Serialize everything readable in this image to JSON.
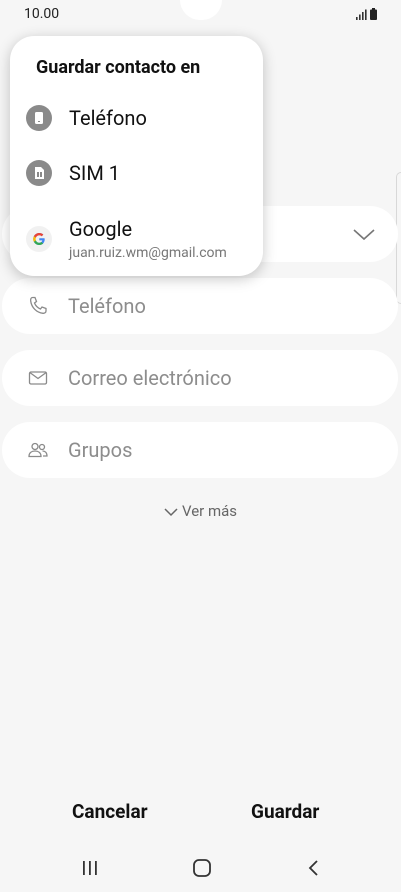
{
  "status_bar": {
    "time": "10.00"
  },
  "popup": {
    "title": "Guardar contacto en",
    "options": [
      {
        "label": "Teléfono",
        "icon": "phone-storage-icon"
      },
      {
        "label": "SIM 1",
        "icon": "sim-card-icon"
      },
      {
        "label": "Google",
        "sub": "juan.ruiz.wm@gmail.com",
        "icon": "google-icon"
      }
    ]
  },
  "form": {
    "phone_placeholder": "Teléfono",
    "email_placeholder": "Correo electrónico",
    "groups_placeholder": "Grupos",
    "more_label": "Ver más"
  },
  "actions": {
    "cancel": "Cancelar",
    "save": "Guardar"
  },
  "colors": {
    "background": "#f6f6f6",
    "field": "#ffffff",
    "icon_gray": "#8a8a8a"
  }
}
